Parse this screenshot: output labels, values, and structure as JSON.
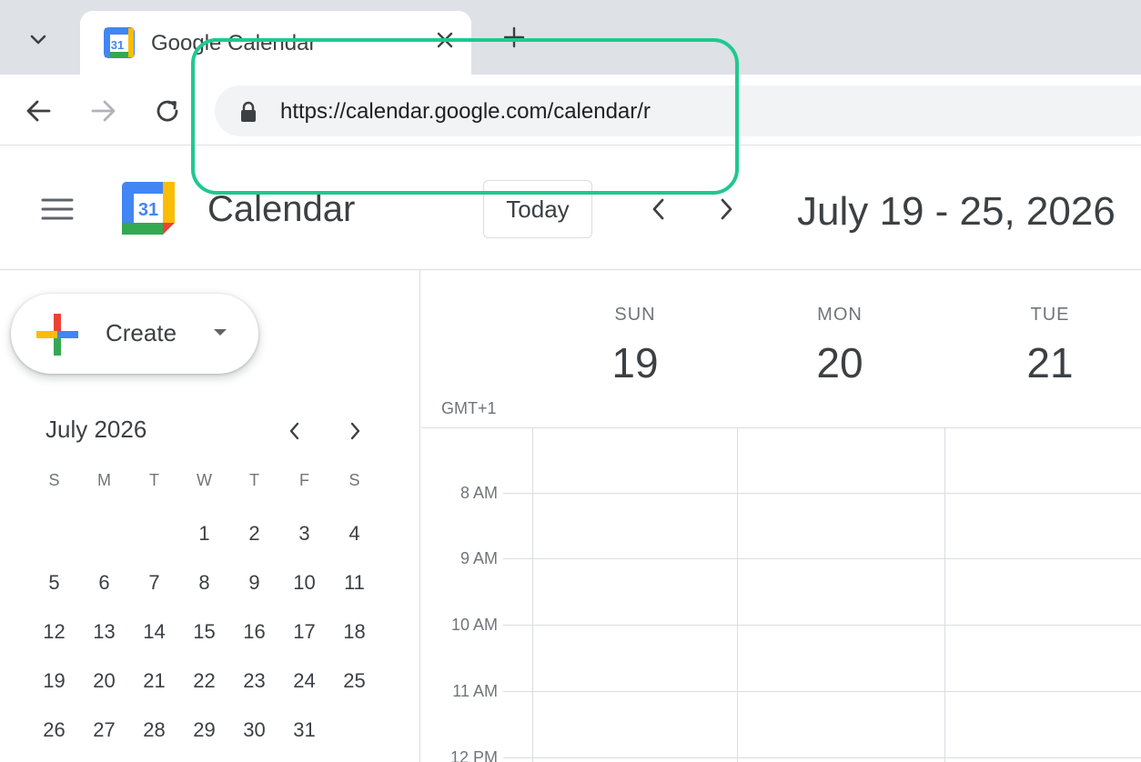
{
  "browser": {
    "tab": {
      "title": "Google Calendar",
      "favicon_day": "31"
    },
    "url": "https://calendar.google.com/calendar/r",
    "icons": [
      "chevron-down-icon",
      "close-icon",
      "new-tab-icon",
      "back-icon",
      "forward-icon",
      "reload-icon",
      "lock-icon"
    ]
  },
  "header": {
    "app_title": "Calendar",
    "logo_day": "31",
    "today_label": "Today",
    "date_range": "July 19 - 25, 2026"
  },
  "sidebar": {
    "create_label": "Create",
    "mini_calendar": {
      "title": "July 2026",
      "weekdays": [
        "S",
        "M",
        "T",
        "W",
        "T",
        "F",
        "S"
      ],
      "days": [
        "",
        "",
        "",
        "1",
        "2",
        "3",
        "4",
        "5",
        "6",
        "7",
        "8",
        "9",
        "10",
        "11",
        "12",
        "13",
        "14",
        "15",
        "16",
        "17",
        "18",
        "19",
        "20",
        "21",
        "22",
        "23",
        "24",
        "25",
        "26",
        "27",
        "28",
        "29",
        "30",
        "31",
        ""
      ]
    }
  },
  "week": {
    "timezone": "GMT+1",
    "days": [
      {
        "dow": "SUN",
        "dom": "19"
      },
      {
        "dow": "MON",
        "dom": "20"
      },
      {
        "dow": "TUE",
        "dom": "21"
      }
    ],
    "hours": [
      "8 AM",
      "9 AM",
      "10 AM",
      "11 AM",
      "12 PM"
    ]
  },
  "colors": {
    "highlight": "#1ec98e",
    "google_blue": "#4285f4",
    "google_red": "#ea4335",
    "google_yellow": "#fbbc04",
    "google_green": "#34a853"
  }
}
